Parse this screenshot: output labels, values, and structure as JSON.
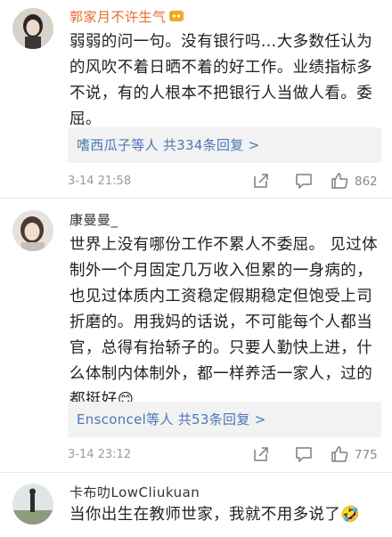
{
  "comments": [
    {
      "username": "郭家月不许生气",
      "text": "弱弱的问一句。没有银行吗…大多数任认为的风吹不着日晒不着的好工作。业绩指标多不说，有的人根本不把银行人当做人看。委屈。",
      "reply_summary": "嗜西瓜子等人  共334条回复 >",
      "time": "3-14 21:58",
      "likes": "862"
    },
    {
      "username": "康曼曼_",
      "text": "世界上没有哪份工作不累人不委屈。 见过体制外一个月固定几万收入但累的一身病的，也见过体质内工资稳定假期稳定但饱受上司折磨的。用我妈的话说，不可能每个人都当官，总得有抬轿子的。只要人勤快上进，什么体制内体制外，都一样养活一家人，过的都挺好😊",
      "reply_summary": "Ensconcel等人  共53条回复 >",
      "time": "3-14 23:12",
      "likes": "775"
    },
    {
      "username": "卡布叻LowCliukuan",
      "text": "当你出生在教师世家，我就不用多说了🤣"
    }
  ],
  "icons": {
    "share": "share-icon",
    "comment": "comment-icon",
    "like": "thumbs-up-icon",
    "badge": "vip-badge-icon"
  }
}
